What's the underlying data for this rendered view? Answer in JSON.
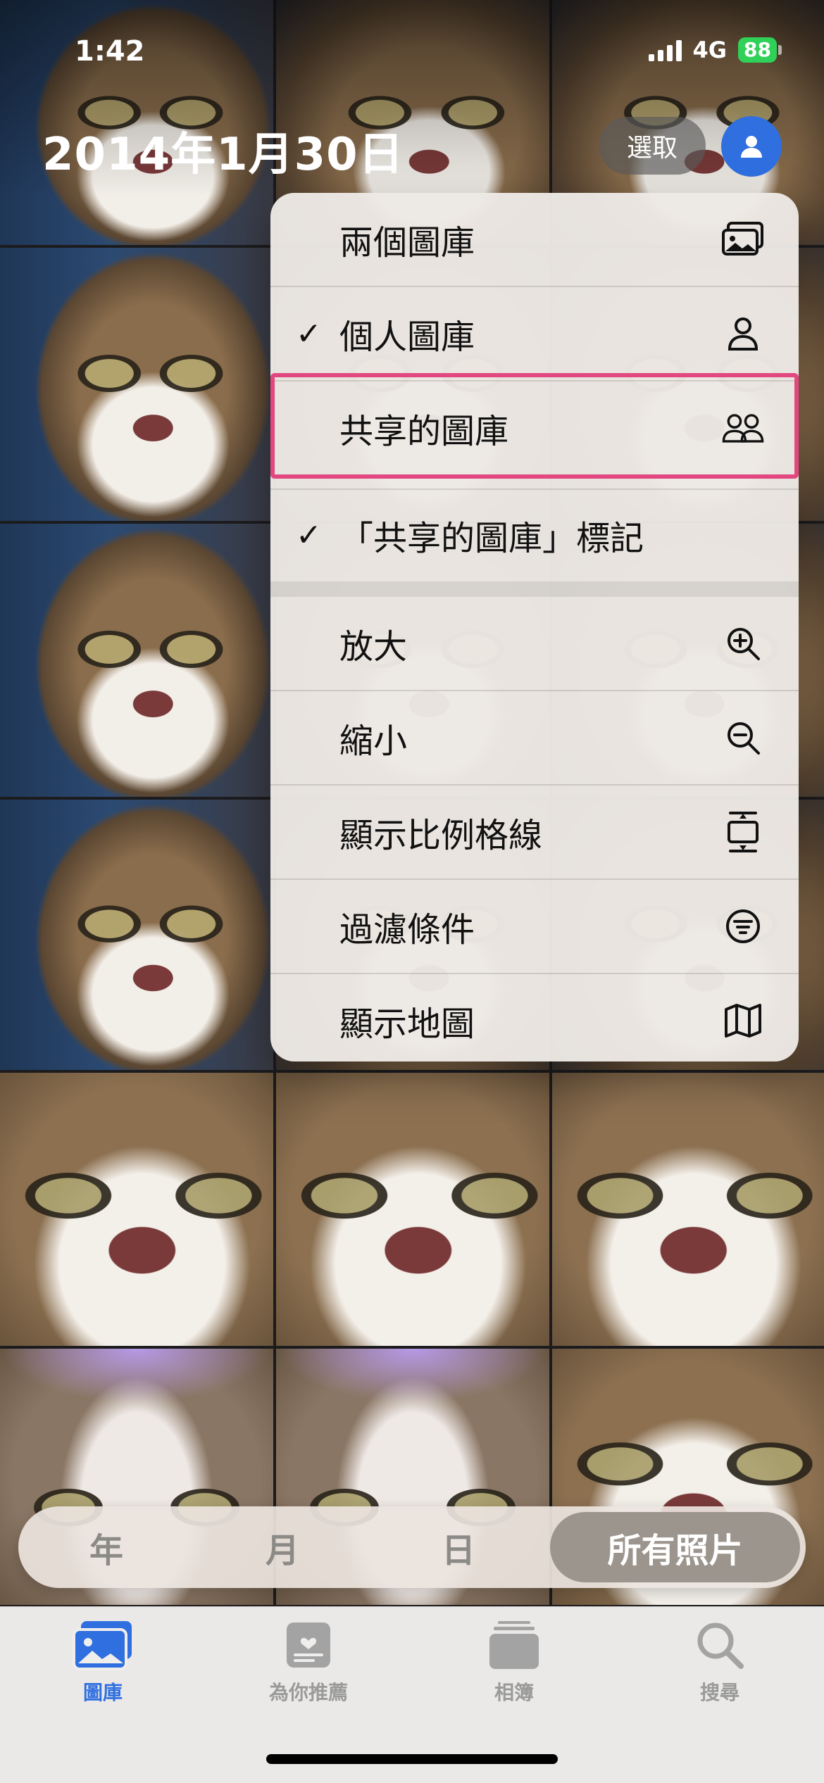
{
  "status_bar": {
    "time": "1:42",
    "network": "4G",
    "battery": "88"
  },
  "header": {
    "date_title": "2014年1月30日",
    "select_label": "選取"
  },
  "menu": {
    "items": [
      {
        "label": "兩個圖庫",
        "checked": false,
        "icon": "photos-stack-icon"
      },
      {
        "label": "個人圖庫",
        "checked": true,
        "icon": "person-icon"
      },
      {
        "label": "共享的圖庫",
        "checked": false,
        "icon": "two-people-icon",
        "highlighted": true
      },
      {
        "label": "「共享的圖庫」標記",
        "checked": true,
        "icon": ""
      },
      {
        "label": "放大",
        "checked": false,
        "icon": "zoom-in-icon"
      },
      {
        "label": "縮小",
        "checked": false,
        "icon": "zoom-out-icon"
      },
      {
        "label": "顯示比例格線",
        "checked": false,
        "icon": "aspect-grid-icon"
      },
      {
        "label": "過濾條件",
        "checked": false,
        "icon": "filter-icon"
      },
      {
        "label": "顯示地圖",
        "checked": false,
        "icon": "map-icon"
      }
    ],
    "check_mark": "✓",
    "highlight_color": "#e3477f"
  },
  "segmented": {
    "options": [
      "年",
      "月",
      "日",
      "所有照片"
    ],
    "selected": "所有照片"
  },
  "tabbar": {
    "tabs": [
      {
        "label": "圖庫",
        "icon": "library-icon",
        "active": true
      },
      {
        "label": "為你推薦",
        "icon": "for-you-icon",
        "active": false
      },
      {
        "label": "相簿",
        "icon": "albums-icon",
        "active": false
      },
      {
        "label": "搜尋",
        "icon": "search-icon",
        "active": false
      }
    ]
  },
  "colors": {
    "accent": "#2f6fe0",
    "battery": "#30d158"
  }
}
